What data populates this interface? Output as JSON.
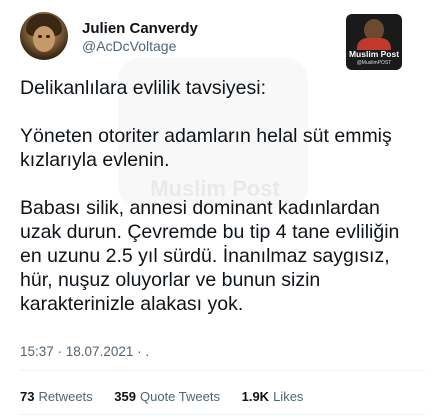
{
  "author": {
    "display_name": "Julien Canverdy",
    "handle": "@AcDcVoltage",
    "avatar_icon": "profile-photo"
  },
  "watermark": {
    "title": "Muslim Post",
    "subtitle": "@MuslimPOST",
    "center_text": "Muslim Post",
    "icon": "muslim-post-logo"
  },
  "tweet": {
    "paragraphs": [
      "Delikanlılara evlilik tavsiyesi:",
      "Yöneten otoriter adamların helal süt emmiş kızlarıyla evlenin.",
      "Babası silik, annesi dominant kadınlardan uzak durun. Çevremde bu tip 4 tane evliliğin en uzunu 2.5 yıl sürdü. İnanılmaz saygısız, hür, nuşuz oluyorlar ve bunun sizin karakterinizle alakası yok."
    ],
    "timestamp": "15:37 · 18.07.2021 · ."
  },
  "stats": {
    "retweets": {
      "count": "73",
      "label": "Retweets"
    },
    "quote_tweets": {
      "count": "359",
      "label": "Quote Tweets"
    },
    "likes": {
      "count": "1.9K",
      "label": "Likes"
    }
  }
}
